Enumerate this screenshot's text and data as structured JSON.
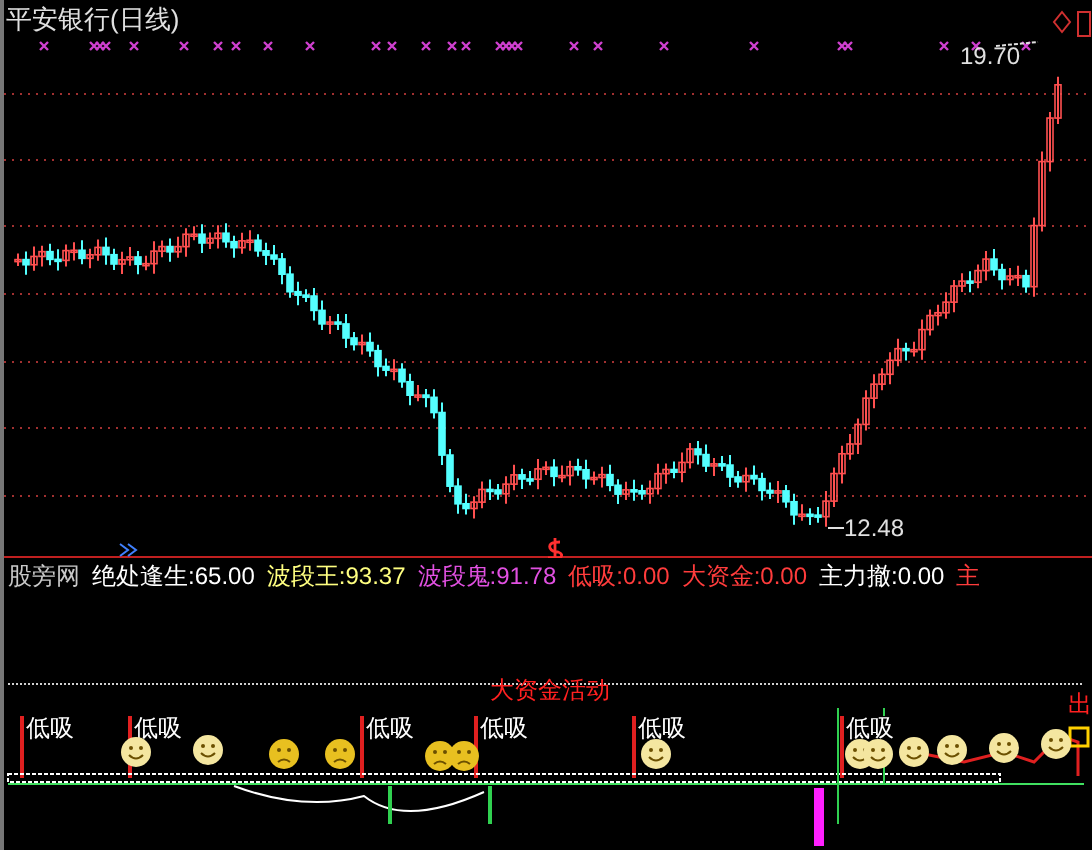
{
  "chart": {
    "title": "平安银行(日线)",
    "high_label": "19.70",
    "low_label": "12.48"
  },
  "indicator_values": [
    {
      "name": "股旁网",
      "color": "#c8c8c8"
    },
    {
      "name": "绝处逢生:",
      "value": "65.00",
      "color": "#ffffff"
    },
    {
      "name": "波段王:",
      "value": "93.37",
      "color": "#ffff80"
    },
    {
      "name": "波段鬼:",
      "value": "91.78",
      "color": "#e050e0"
    },
    {
      "name": "低吸:",
      "value": "0.00",
      "color": "#ff3c3c"
    },
    {
      "name": "大资金:",
      "value": "0.00",
      "color": "#ff3c3c"
    },
    {
      "name": "主力撤:",
      "value": "0.00",
      "color": "#ffffff"
    },
    {
      "name": "主",
      "color": "#ff3c3c"
    }
  ],
  "indicator_panel": {
    "event_label": "大资金活动",
    "exit_label": "出",
    "buy_labels": [
      "低吸",
      "低吸",
      "低吸",
      "低吸",
      "低吸",
      "低吸"
    ],
    "faces": [
      {
        "kind": "happy"
      },
      {
        "kind": "happy"
      },
      {
        "kind": "sad"
      },
      {
        "kind": "sad"
      },
      {
        "kind": "sad"
      },
      {
        "kind": "sad"
      },
      {
        "kind": "happy"
      },
      {
        "kind": "happy"
      },
      {
        "kind": "happy"
      },
      {
        "kind": "happy"
      },
      {
        "kind": "happy"
      },
      {
        "kind": "happy"
      },
      {
        "kind": "happy"
      }
    ]
  }
}
